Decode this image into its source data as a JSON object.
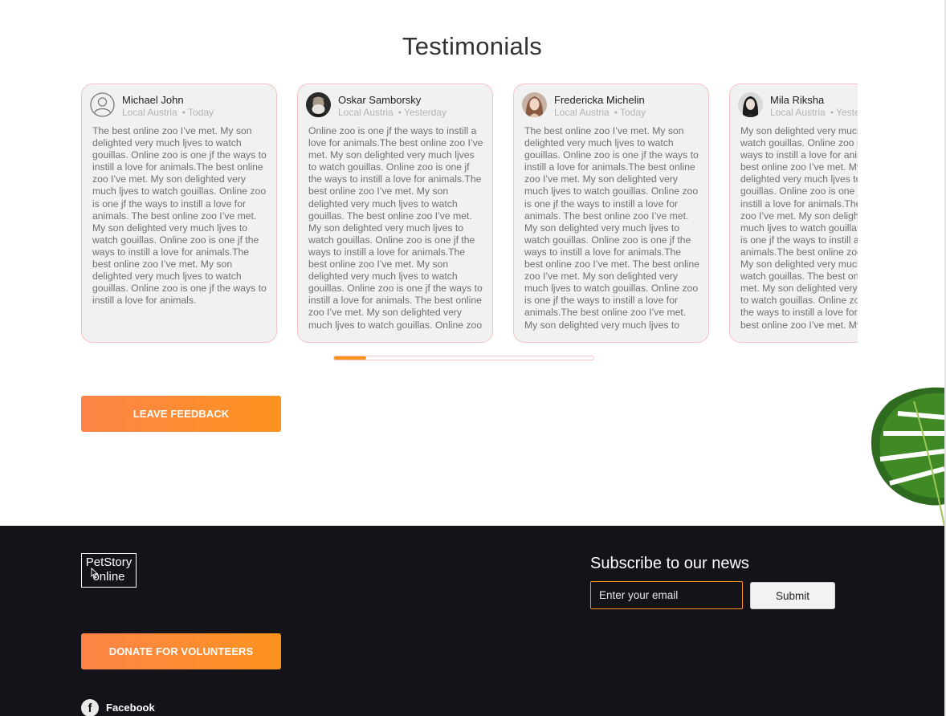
{
  "testimonials": {
    "title": "Testimonials",
    "cards": [
      {
        "name": "Michael John",
        "location": "Local Austria",
        "time": "• Today",
        "avatar": "default-user-icon",
        "text": "The best online zoo I’ve met. My son delighted very much ljves to watch gouillas. Online zoo is one jf the ways to instill a love for animals.The best online zoo I’ve met. My son delighted very much ljves to watch gouillas. Online zoo is one jf the ways to instill a love for animals. The best online zoo I’ve met. My son delighted very much ljves to watch gouillas. Online zoo is one jf the ways to instill a love for animals.The best online zoo I’ve met. My son delighted very much ljves to watch gouillas. Online zoo is one jf the ways to instill a love for animals."
      },
      {
        "name": "Oskar Samborsky",
        "location": "Local Austria",
        "time": "• Yesterday",
        "avatar": "photo-oskar",
        "text": "Online zoo is one jf the ways to instill a love for animals.The best online zoo I’ve met. My son delighted very much ljves to watch gouillas. Online zoo is one jf the ways to instill a love for animals.The best online zoo I’ve met. My son delighted very much ljves to watch gouillas. The best online zoo I’ve met. My son delighted very much ljves to watch gouillas. Online zoo is one jf the ways to instill a love for animals.The best online zoo I’ve met. My son delighted very much ljves to watch gouillas. Online zoo is one jf the ways to instill a love for animals. The best online zoo I’ve met. My son delighted very much ljves to watch gouillas. Online zoo"
      },
      {
        "name": "Fredericka Michelin",
        "location": "Local Austria",
        "time": "• Today",
        "avatar": "photo-fredericka",
        "text": "The best online zoo I’ve met. My son delighted very much ljves to watch gouillas. Online zoo is one jf the ways to instill a love for animals.The best online zoo I’ve met. My son delighted very much ljves to watch gouillas. Online zoo is one jf the ways to instill a love for animals. The best online zoo I’ve met. My son delighted very much ljves to watch gouillas. Online zoo is one jf the ways to instill a love for animals.The best online zoo I’ve met. The best online zoo I’ve met. My son delighted very much ljves to watch gouillas. Online zoo is one jf the ways to instill a love for animals.The best online zoo I’ve met. My son delighted very much ljves to"
      },
      {
        "name": "Mila Riksha",
        "location": "Local Austria",
        "time": "• Yesterday",
        "avatar": "photo-mila",
        "text": "My son delighted very much ljves to watch gouillas. Online zoo is one jf the ways to instill a love for animals.The best online zoo I’ve met. My son delighted very much ljves to watch gouillas. Online zoo is one jf the ways to instill a love for animals.The best online zoo I’ve met. My son delighted very much ljves to watch gouillas. Online zoo is one jf the ways to instill a love for animals.The best online zoo I’ve met. My son delighted very much ljves to watch gouillas. The best online zoo I’ve met. My son delighted very much ljves to watch gouillas. Online zoo is one jf the ways to instill a love for animals. The best online zoo I’ve met. My son"
      }
    ],
    "carousel_progress_percent": 12.5,
    "leave_feedback_label": "LEAVE FEEDBACK"
  },
  "footer": {
    "logo_line1": "PetStory",
    "logo_line2": "online",
    "subscribe_title": "Subscribe to our news",
    "email_placeholder": "Enter your email",
    "submit_label": "Submit",
    "donate_label": "DONATE FOR VOLUNTEERS",
    "social": [
      {
        "icon": "facebook-icon",
        "glyph": "f",
        "label": "Facebook"
      }
    ]
  },
  "colors": {
    "accent_orange": "#f7931e",
    "gradient_start": "#fd8448",
    "gradient_end": "#fd931f",
    "footer_bg": "#141319",
    "card_bg": "#f0f1f0",
    "card_border": "#f4c3c6"
  }
}
